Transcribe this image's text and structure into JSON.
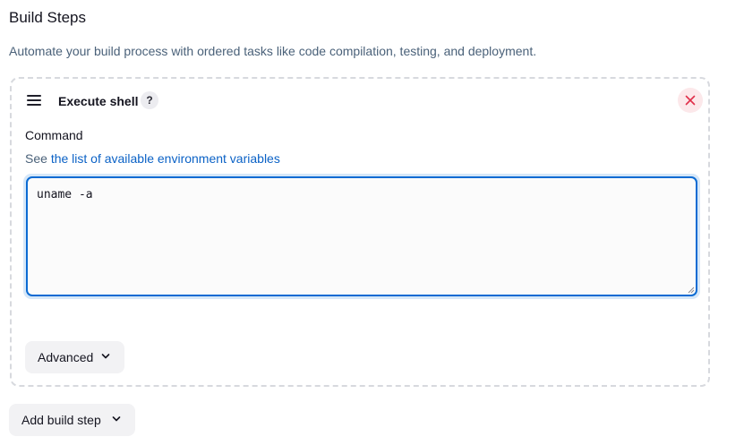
{
  "section": {
    "title": "Build Steps",
    "description": "Automate your build process with ordered tasks like code compilation, testing, and deployment."
  },
  "step": {
    "title": "Execute shell",
    "help_label": "?",
    "command_label": "Command",
    "hint_prefix": "See ",
    "hint_link": "the list of available environment variables",
    "command_value": "uname -a",
    "advanced_label": "Advanced"
  },
  "add_step": {
    "label": "Add build step"
  },
  "icons": {
    "drag": "drag-handle-icon",
    "help": "help-icon",
    "close": "close-icon",
    "chevron": "chevron-down-icon"
  },
  "colors": {
    "link": "#0b62c6",
    "focus_border": "#0b6bd3",
    "close_bg": "#fce8ea",
    "close_x": "#e0304a"
  }
}
